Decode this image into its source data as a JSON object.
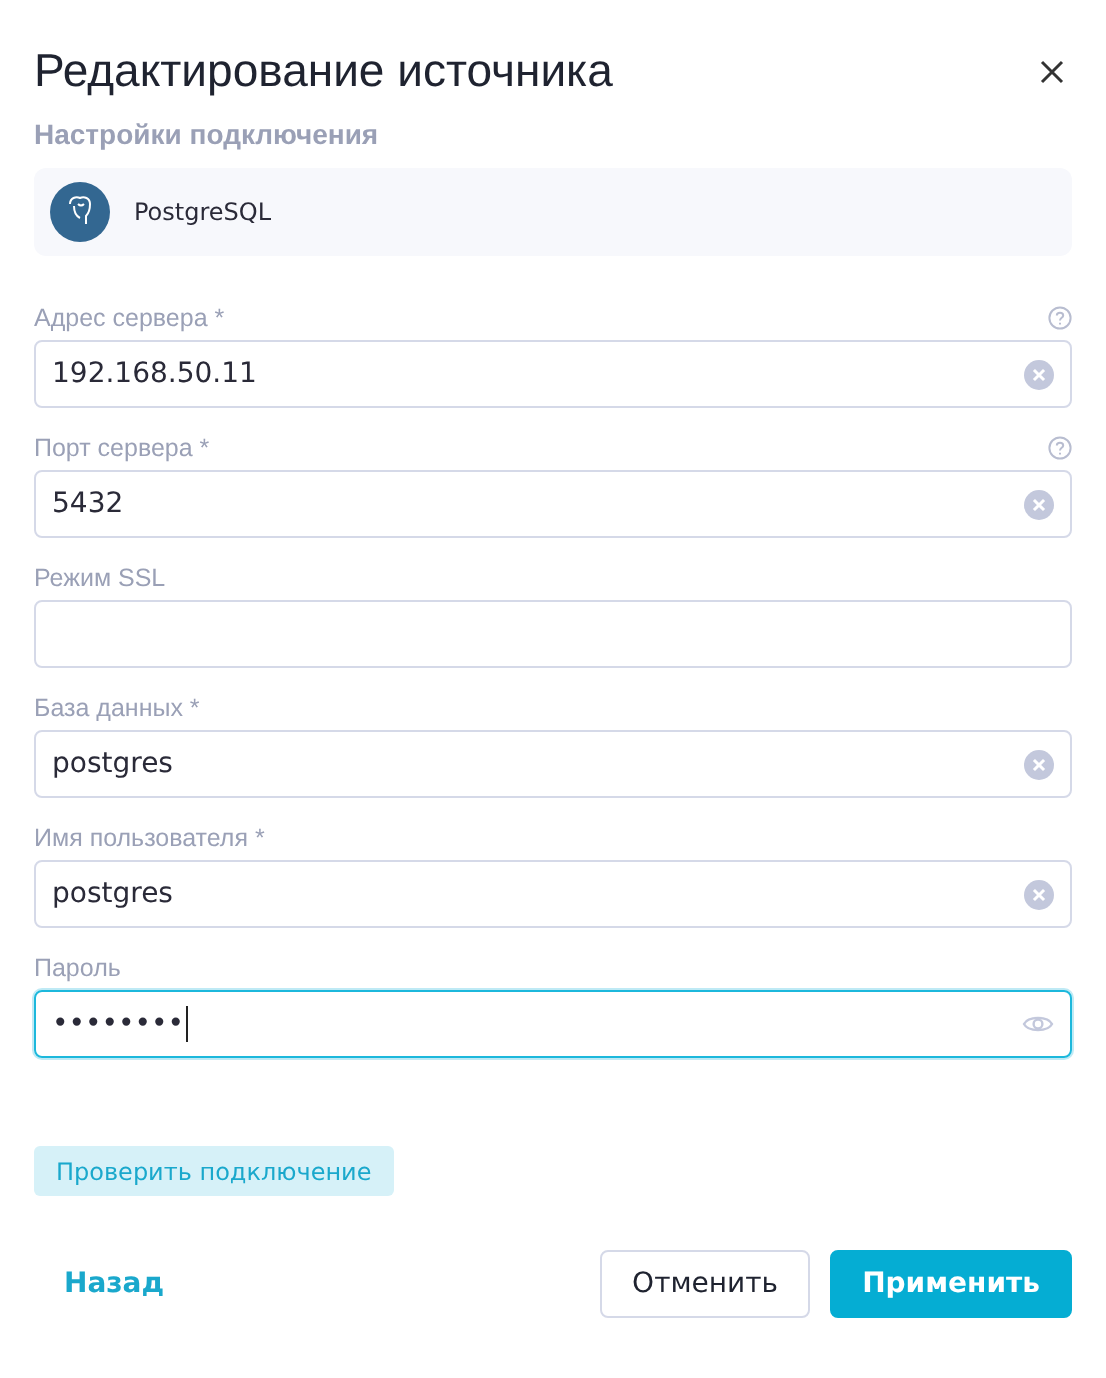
{
  "dialog": {
    "title": "Редактирование источника",
    "subtitle": "Настройки подключения"
  },
  "source": {
    "name": "PostgreSQL"
  },
  "fields": [
    {
      "label": "Адрес сервера *",
      "help": true,
      "kind": "text",
      "value": "192.168.50.11",
      "clearable": true,
      "focused": false
    },
    {
      "label": "Порт сервера *",
      "help": true,
      "kind": "text",
      "value": "5432",
      "clearable": true,
      "focused": false
    },
    {
      "label": "Режим SSL",
      "help": false,
      "kind": "text",
      "clearable": false,
      "focused": false
    },
    {
      "label": "База данных *",
      "help": false,
      "kind": "text",
      "value": "postgres",
      "clearable": true,
      "focused": false
    },
    {
      "label": "Имя пользователя *",
      "help": false,
      "kind": "text",
      "value": "postgres",
      "clearable": true,
      "focused": false
    },
    {
      "label": "Пароль",
      "help": false,
      "kind": "password",
      "value": "••••••••",
      "clearable": false,
      "focused": true
    }
  ],
  "check_button": "Проверить подключение",
  "footer": {
    "back": "Назад",
    "cancel": "Отменить",
    "apply": "Применить"
  }
}
